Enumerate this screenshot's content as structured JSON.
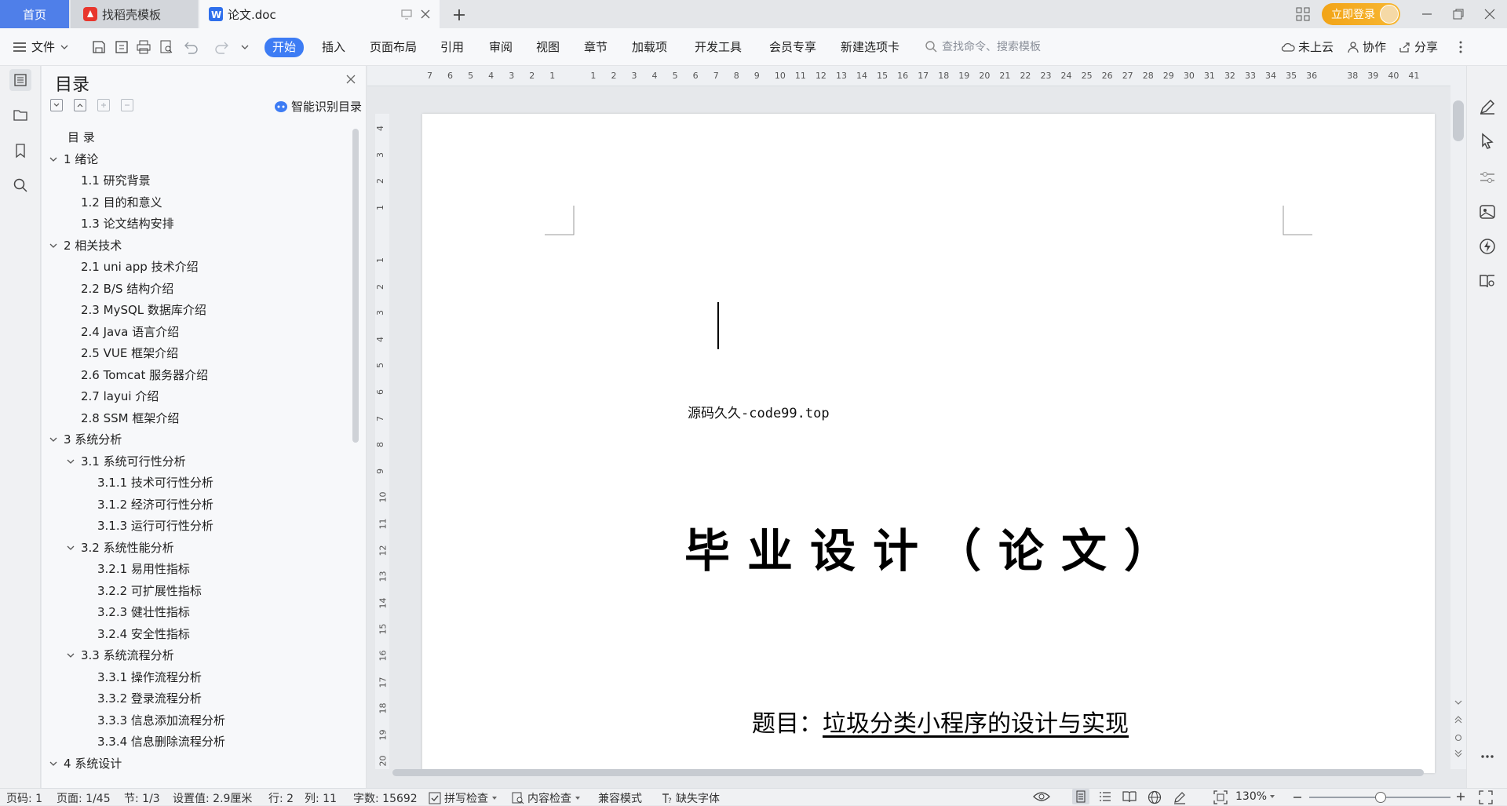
{
  "titlebar": {
    "tabs": [
      {
        "label": "首页"
      },
      {
        "label": "找稻壳模板"
      },
      {
        "label": "论文.doc"
      }
    ],
    "login_label": "立即登录"
  },
  "menubar": {
    "file_label": "文件",
    "items": [
      "开始",
      "插入",
      "页面布局",
      "引用",
      "审阅",
      "视图",
      "章节",
      "加载项",
      "开发工具",
      "会员专享",
      "新建选项卡"
    ],
    "search_placeholder": "查找命令、搜索模板",
    "cloud_label": "未上云",
    "collab_label": "协作",
    "share_label": "分享"
  },
  "toc": {
    "title": "目录",
    "smart_label": "智能识别目录",
    "items": [
      {
        "label": "目  录",
        "level": 1,
        "expandable": false
      },
      {
        "label": "1  绪论",
        "level": 1,
        "expandable": true
      },
      {
        "label": "1.1  研究背景",
        "level": 2,
        "expandable": false
      },
      {
        "label": "1.2  目的和意义",
        "level": 2,
        "expandable": false
      },
      {
        "label": "1.3  论文结构安排",
        "level": 2,
        "expandable": false
      },
      {
        "label": "2  相关技术",
        "level": 1,
        "expandable": true
      },
      {
        "label": "2.1 uni app 技术介绍",
        "level": 2,
        "expandable": false
      },
      {
        "label": "2.2 B/S 结构介绍",
        "level": 2,
        "expandable": false
      },
      {
        "label": "2.3 MySQL 数据库介绍",
        "level": 2,
        "expandable": false
      },
      {
        "label": "2.4 Java 语言介绍",
        "level": 2,
        "expandable": false
      },
      {
        "label": "2.5 VUE 框架介绍",
        "level": 2,
        "expandable": false
      },
      {
        "label": "2.6 Tomcat 服务器介绍",
        "level": 2,
        "expandable": false
      },
      {
        "label": "2.7 layui 介绍",
        "level": 2,
        "expandable": false
      },
      {
        "label": "2.8 SSM 框架介绍",
        "level": 2,
        "expandable": false
      },
      {
        "label": "3  系统分析",
        "level": 1,
        "expandable": true
      },
      {
        "label": "3.1  系统可行性分析",
        "level": 2,
        "expandable": true
      },
      {
        "label": "3.1.1  技术可行性分析",
        "level": 3,
        "expandable": false
      },
      {
        "label": "3.1.2  经济可行性分析",
        "level": 3,
        "expandable": false
      },
      {
        "label": "3.1.3  运行可行性分析",
        "level": 3,
        "expandable": false
      },
      {
        "label": "3.2  系统性能分析",
        "level": 2,
        "expandable": true
      },
      {
        "label": "3.2.1  易用性指标",
        "level": 3,
        "expandable": false
      },
      {
        "label": "3.2.2  可扩展性指标",
        "level": 3,
        "expandable": false
      },
      {
        "label": "3.2.3  健壮性指标",
        "level": 3,
        "expandable": false
      },
      {
        "label": "3.2.4  安全性指标",
        "level": 3,
        "expandable": false
      },
      {
        "label": "3.3  系统流程分析",
        "level": 2,
        "expandable": true
      },
      {
        "label": "3.3.1  操作流程分析",
        "level": 3,
        "expandable": false
      },
      {
        "label": "3.3.2  登录流程分析",
        "level": 3,
        "expandable": false
      },
      {
        "label": "3.3.3  信息添加流程分析",
        "level": 3,
        "expandable": false
      },
      {
        "label": "3.3.4  信息删除流程分析",
        "level": 3,
        "expandable": false
      },
      {
        "label": "4  系统设计",
        "level": 1,
        "expandable": true
      }
    ]
  },
  "ruler": {
    "h_numbers": [
      "7",
      "6",
      "5",
      "4",
      "3",
      "2",
      "1",
      "",
      "1",
      "2",
      "3",
      "4",
      "5",
      "6",
      "7",
      "8",
      "9",
      "10",
      "11",
      "12",
      "13",
      "14",
      "15",
      "16",
      "17",
      "18",
      "19",
      "20",
      "21",
      "22",
      "23",
      "24",
      "25",
      "26",
      "27",
      "28",
      "29",
      "30",
      "31",
      "32",
      "33",
      "34",
      "35",
      "36",
      "",
      "38",
      "39",
      "40",
      "41"
    ],
    "v_numbers": [
      "4",
      "3",
      "2",
      "1",
      "",
      "1",
      "2",
      "3",
      "4",
      "5",
      "6",
      "7",
      "8",
      "9",
      "10",
      "11",
      "12",
      "13",
      "14",
      "15",
      "16",
      "17",
      "18",
      "19",
      "20"
    ]
  },
  "document": {
    "source_line": "源码久久-code99.top",
    "main_title": "毕业设计（论文）",
    "subject_label": "题目：",
    "subject_value": "垃圾分类小程序的设计与实现"
  },
  "status": {
    "page_no": "页码: 1",
    "page_of": "页面: 1/45",
    "section": "节: 1/3",
    "setting": "设置值: 2.9厘米",
    "row": "行: 2",
    "col": "列: 11",
    "word_count": "字数: 15692",
    "spell_check": "拼写检查",
    "content_check": "内容检查",
    "compat_mode": "兼容模式",
    "missing_font": "缺失字体",
    "zoom": "130%"
  }
}
